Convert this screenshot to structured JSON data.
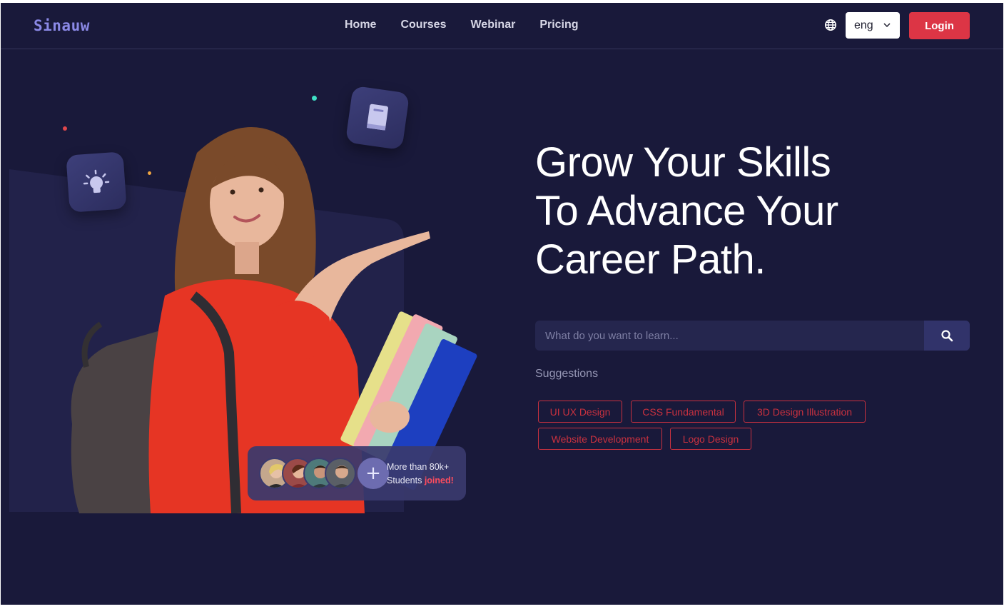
{
  "nav": {
    "logo": "Sinauw",
    "links": [
      "Home",
      "Courses",
      "Webinar",
      "Pricing"
    ],
    "language": "eng",
    "login_label": "Login"
  },
  "hero": {
    "headline_lines": [
      "Grow Your Skills",
      "To Advance Your",
      "Career Path."
    ],
    "search_placeholder": "What do you want to learn...",
    "suggestions_title": "Suggestions",
    "suggestions": [
      "UI UX Design",
      "CSS Fundamental",
      "3D Design Illustration",
      "Website Development",
      "Logo Design"
    ],
    "students_line1": "More than 80k+",
    "students_line2_prefix": "Students ",
    "students_line2_highlight": "joined!"
  },
  "colors": {
    "background": "#19193a",
    "accent": "#dc3545",
    "logo": "#8b89e6"
  },
  "icons": [
    "globe-icon",
    "chevron-down-icon",
    "search-icon",
    "lightbulb-icon",
    "book-icon",
    "plus-icon"
  ]
}
